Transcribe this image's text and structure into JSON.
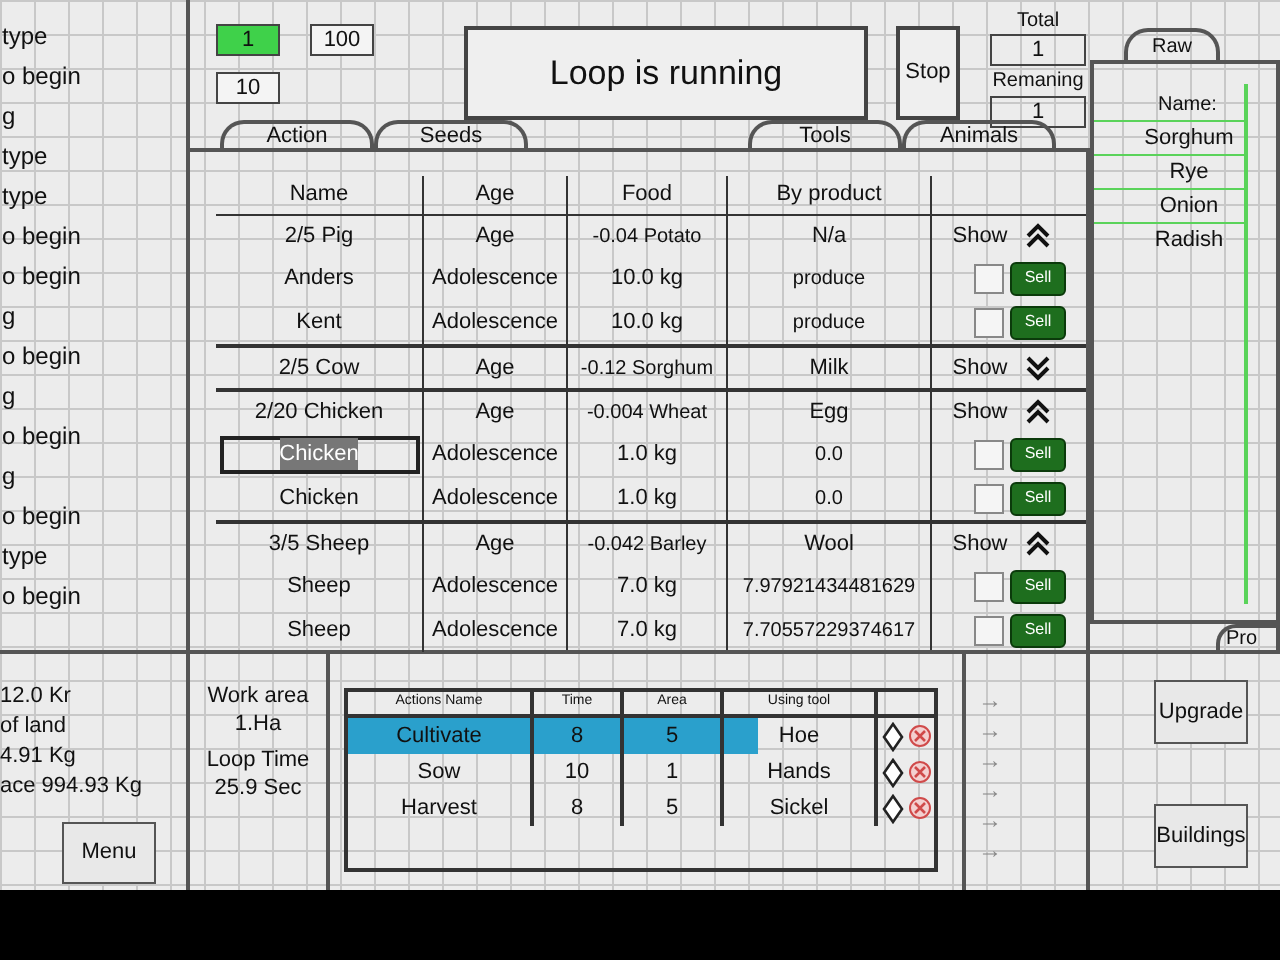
{
  "log": [
    "type",
    "o begin",
    "g",
    "type",
    "type",
    "o begin",
    "o begin",
    "g",
    "o begin",
    "g",
    "o begin",
    "g",
    "o begin",
    "type",
    "o begin"
  ],
  "counters": [
    {
      "value": "1",
      "highlighted": true
    },
    {
      "value": "100",
      "highlighted": false
    },
    {
      "value": "10",
      "highlighted": false
    }
  ],
  "status": "Loop is running",
  "stop_button": "Stop",
  "total": {
    "label": "Total",
    "value": "1"
  },
  "remaining": {
    "label": "Remaning",
    "value": "1"
  },
  "tabs": [
    {
      "label": "Action"
    },
    {
      "label": "Seeds"
    },
    {
      "label": "Tools"
    },
    {
      "label": "Animals"
    }
  ],
  "table": {
    "columns": [
      "Name",
      "Age",
      "Food",
      "By product"
    ],
    "groups": [
      {
        "name": "2/5 Pig",
        "age": "Age",
        "food": "-0.04 Potato",
        "by_product": "N/a",
        "show": "Show",
        "expanded": true,
        "rows": [
          {
            "name": "Anders",
            "age": "Adolescence",
            "food": "10.0 kg",
            "by_product": "produce",
            "checked": false,
            "editing": false,
            "sell": "Sell"
          },
          {
            "name": "Kent",
            "age": "Adolescence",
            "food": "10.0 kg",
            "by_product": "produce",
            "checked": false,
            "editing": false,
            "sell": "Sell"
          }
        ]
      },
      {
        "name": "2/5 Cow",
        "age": "Age",
        "food": "-0.12 Sorghum",
        "by_product": "Milk",
        "show": "Show",
        "expanded": false
      },
      {
        "name": "2/20 Chicken",
        "age": "Age",
        "food": "-0.004 Wheat",
        "by_product": "Egg",
        "show": "Show",
        "expanded": true,
        "rows": [
          {
            "name": "Chicken",
            "age": "Adolescence",
            "food": "1.0 kg",
            "by_product": "0.0",
            "checked": false,
            "editing": true,
            "sell": "Sell"
          },
          {
            "name": "Chicken",
            "age": "Adolescence",
            "food": "1.0 kg",
            "by_product": "0.0",
            "checked": false,
            "editing": false,
            "sell": "Sell"
          }
        ]
      },
      {
        "name": "3/5 Sheep",
        "age": "Age",
        "food": "-0.042 Barley",
        "by_product": "Wool",
        "show": "Show",
        "expanded": true,
        "rows": [
          {
            "name": "Sheep",
            "age": "Adolescence",
            "food": "7.0 kg",
            "by_product": "7.97921434481629",
            "checked": false,
            "editing": false,
            "sell": "Sell"
          },
          {
            "name": "Sheep",
            "age": "Adolescence",
            "food": "7.0 kg",
            "by_product": "7.70557229374617",
            "checked": false,
            "editing": false,
            "sell": "Sell"
          }
        ]
      }
    ]
  },
  "raw": {
    "tab": "Raw",
    "header": "Name:",
    "items": [
      "Sorghum",
      "Rye",
      "Onion",
      "Radish"
    ]
  },
  "pro_tab": "Pro",
  "stats": [
    "12.0 Kr",
    "of land",
    "4.91 Kg",
    "ace 994.93 Kg"
  ],
  "menu_button": "Menu",
  "work": {
    "area_label": "Work area",
    "area": "1.Ha",
    "loop_label": "Loop Time",
    "loop": "25.9 Sec"
  },
  "actions": {
    "columns": [
      "Actions Name",
      "Time",
      "Area",
      "Using tool"
    ],
    "rows": [
      {
        "name": "Cultivate",
        "time": "8",
        "area": "5",
        "tool": "Hoe",
        "active": true
      },
      {
        "name": "Sow",
        "time": "10",
        "area": "1",
        "tool": "Hands",
        "active": false
      },
      {
        "name": "Harvest",
        "time": "8",
        "area": "5",
        "tool": "Sickel",
        "active": false
      }
    ]
  },
  "arrows": [
    "→",
    "→",
    "→",
    "→",
    "→",
    "→"
  ],
  "buttons": [
    "Upgrade",
    "Buildings"
  ]
}
